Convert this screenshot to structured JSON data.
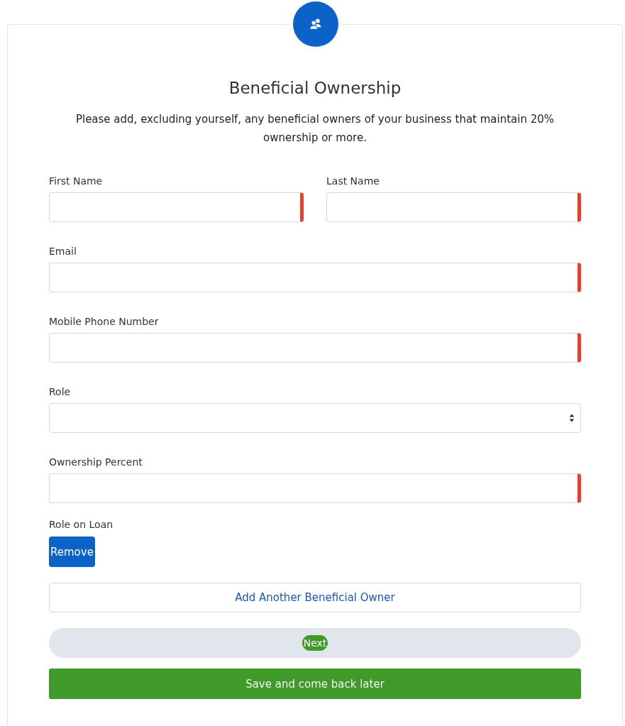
{
  "title": "Beneficial Ownership",
  "intro": "Please add, excluding yourself, any beneficial owners of your business that maintain 20% ownership or more.",
  "rows": [
    [
      {
        "label": "First Name",
        "kind": "text",
        "required": true
      },
      {
        "label": "Last Name",
        "kind": "text",
        "required": true
      }
    ],
    [
      {
        "label": "Email",
        "kind": "text",
        "required": true
      }
    ],
    [
      {
        "label": "Mobile Phone Number",
        "kind": "text",
        "required": true
      }
    ],
    [
      {
        "label": "Role",
        "kind": "select",
        "required": false
      }
    ],
    [
      {
        "label": "Ownership Percent",
        "kind": "text",
        "required": true
      }
    ]
  ],
  "role_on_loan": {
    "label": "Role on Loan",
    "button": "Remove"
  },
  "add_button": "Add Another Beneficial Owner",
  "next_button": "Next",
  "save_button": "Save and come back later"
}
